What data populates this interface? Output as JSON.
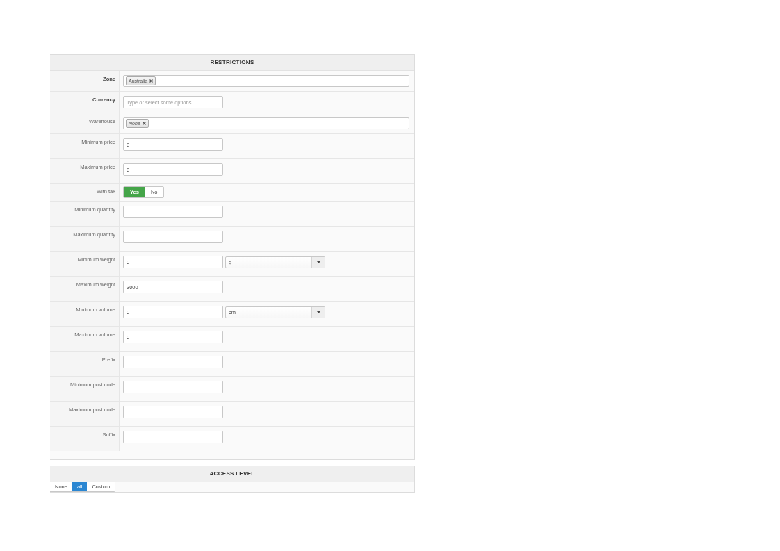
{
  "restrictions": {
    "title": "RESTRICTIONS",
    "fields": [
      {
        "kind": "multiselect",
        "label": "Zone",
        "required": true,
        "tags": [
          {
            "text": "Australia",
            "null_option": false
          }
        ]
      },
      {
        "kind": "multiselect",
        "label": "Currency",
        "required": true,
        "placeholder": "Type or select some options"
      },
      {
        "kind": "multiselect",
        "label": "Warehouse",
        "required": false,
        "tags": [
          {
            "text": "None",
            "null_option": true
          }
        ]
      },
      {
        "kind": "text",
        "label": "Minimum price",
        "required": false,
        "value": "0"
      },
      {
        "kind": "text",
        "label": "Maximum price",
        "required": false,
        "value": "0"
      },
      {
        "kind": "toggle",
        "label": "With tax",
        "required": false,
        "options": [
          {
            "label": "Yes",
            "selected": true
          },
          {
            "label": "No",
            "selected": false
          }
        ]
      },
      {
        "kind": "text",
        "label": "Minimum quantity",
        "required": false
      },
      {
        "kind": "text",
        "label": "Maximum quantity",
        "required": false
      },
      {
        "kind": "text",
        "label": "Minimum weight",
        "required": false,
        "value": "0",
        "unit": "g"
      },
      {
        "kind": "text",
        "label": "Maximum weight",
        "required": false,
        "value": "3000"
      },
      {
        "kind": "text",
        "label": "Minimum volume",
        "required": false,
        "value": "0",
        "unit": "cm"
      },
      {
        "kind": "text",
        "label": "Maximum volume",
        "required": false,
        "value": "0"
      },
      {
        "kind": "text",
        "label": "Prefix",
        "required": false
      },
      {
        "kind": "text",
        "label": "Minimum post code",
        "required": false
      },
      {
        "kind": "text",
        "label": "Maximum post code",
        "required": false
      },
      {
        "kind": "text",
        "label": "Suffix",
        "required": false
      }
    ]
  },
  "access_level": {
    "title": "ACCESS LEVEL",
    "options": [
      {
        "label": "None",
        "selected": false
      },
      {
        "label": "all",
        "selected": true
      },
      {
        "label": "Custom",
        "selected": false
      }
    ]
  }
}
